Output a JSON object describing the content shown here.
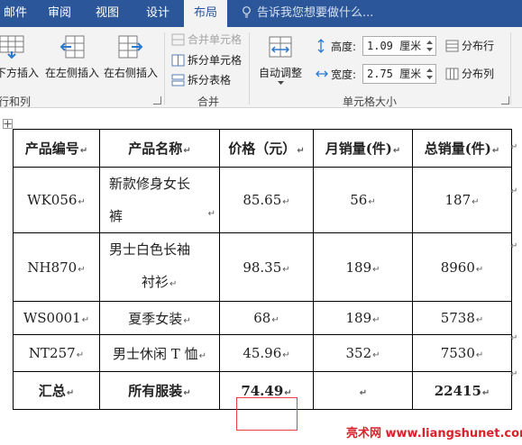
{
  "tabs": [
    {
      "label": "邮件",
      "active": false
    },
    {
      "label": "审阅",
      "active": false
    },
    {
      "label": "视图",
      "active": false
    },
    {
      "label": "设计",
      "active": false
    },
    {
      "label": "布局",
      "active": true
    }
  ],
  "tell_me": "告诉我您想要做什么...",
  "ribbon": {
    "rows_cols": {
      "insert_below": "下方插入",
      "insert_left": "在左侧插入",
      "insert_right": "在右侧插入",
      "group_label": "行和列"
    },
    "merge": {
      "merge_cells": "合并单元格",
      "split_cells": "拆分单元格",
      "split_table": "拆分表格",
      "group_label": "合并"
    },
    "cell_size": {
      "autofit": "自动调整",
      "height_label": "高度:",
      "height_value": "1.09 厘米",
      "width_label": "宽度:",
      "width_value": "2.75 厘米",
      "distribute_rows": "分布行",
      "distribute_cols": "分布列",
      "group_label": "单元格大小"
    }
  },
  "table": {
    "headers": [
      "产品编号",
      "产品名称",
      "价格（元）",
      "月销量(件)",
      "总销量(件)"
    ],
    "rows": [
      {
        "id": "WK056",
        "name_line1": "新款修身女长",
        "name_line2": "裤",
        "price": "85.65",
        "monthly": "56",
        "total": "187"
      },
      {
        "id": "NH870",
        "name_line1": "男士白色长袖",
        "name_line2": "衬衫",
        "price": "98.35",
        "monthly": "189",
        "total": "8960"
      },
      {
        "id": "WS0001",
        "name_line1": "夏季女装",
        "name_line2": "",
        "price": "68",
        "monthly": "189",
        "total": "5738"
      },
      {
        "id": "NT257",
        "name_line1": "男士休闲 T 恤",
        "name_line2": "",
        "price": "45.96",
        "monthly": "352",
        "total": "7530"
      }
    ],
    "total_row": {
      "label": "汇总",
      "name": "所有服装",
      "price": "74.49",
      "monthly": "",
      "total": "22415"
    }
  },
  "watermark": "亮术网 www.liangshunet.com",
  "colors": {
    "title_bar": "#2b579a",
    "ribbon": "#f3f3f3",
    "highlight": "#e8404a",
    "watermark": "#d9212c"
  }
}
